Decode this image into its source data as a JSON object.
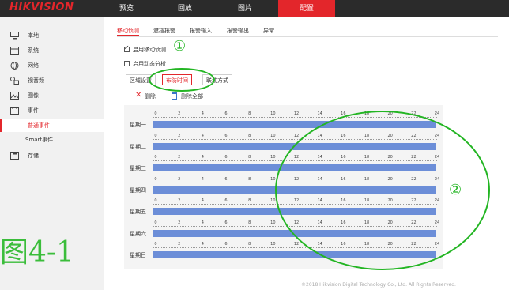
{
  "header": {
    "logo": "HIKVISION",
    "nav": [
      "预览",
      "回放",
      "图片",
      "配置"
    ],
    "active_nav": "配置"
  },
  "sidebar": {
    "items": [
      {
        "label": "本地",
        "icon": "monitor-icon"
      },
      {
        "label": "系统",
        "icon": "system-icon"
      },
      {
        "label": "网络",
        "icon": "globe-icon"
      },
      {
        "label": "视音频",
        "icon": "audio-video-icon"
      },
      {
        "label": "图像",
        "icon": "image-icon"
      },
      {
        "label": "事件",
        "icon": "calendar-icon"
      }
    ],
    "sub_items": [
      "普通事件",
      "Smart事件"
    ],
    "last_item": {
      "label": "存储",
      "icon": "disk-icon"
    }
  },
  "tabs": [
    "移动侦测",
    "遮挡报警",
    "报警输入",
    "报警输出",
    "异常"
  ],
  "active_tab": "移动侦测",
  "options": {
    "enable_motion": {
      "label": "启用移动侦测",
      "checked": true
    },
    "enable_dynamic": {
      "label": "启用动态分析",
      "checked": false
    }
  },
  "subtabs": [
    "区域设置",
    "布防时间",
    "联动方式"
  ],
  "active_subtab": "布防时间",
  "actions": {
    "delete": "删除",
    "delete_all": "删除全部"
  },
  "schedule": {
    "ticks": [
      "0",
      "2",
      "4",
      "6",
      "8",
      "10",
      "12",
      "14",
      "16",
      "18",
      "20",
      "22",
      "24"
    ],
    "days": [
      "星期一",
      "星期二",
      "星期三",
      "星期四",
      "星期五",
      "星期六",
      "星期日"
    ],
    "bar_color": "#6c8ed8"
  },
  "footer": {
    "copyright": "©2018 Hikvision Digital Technology Co., Ltd. All Rights Reserved."
  },
  "annotations": {
    "figure_label": "图4-1",
    "marker1": "①",
    "marker2": "②",
    "color": "#23b523"
  },
  "colors": {
    "brand": "#e3262b",
    "topbar": "#2b2b2b",
    "sidebar": "#f1f1f1"
  }
}
